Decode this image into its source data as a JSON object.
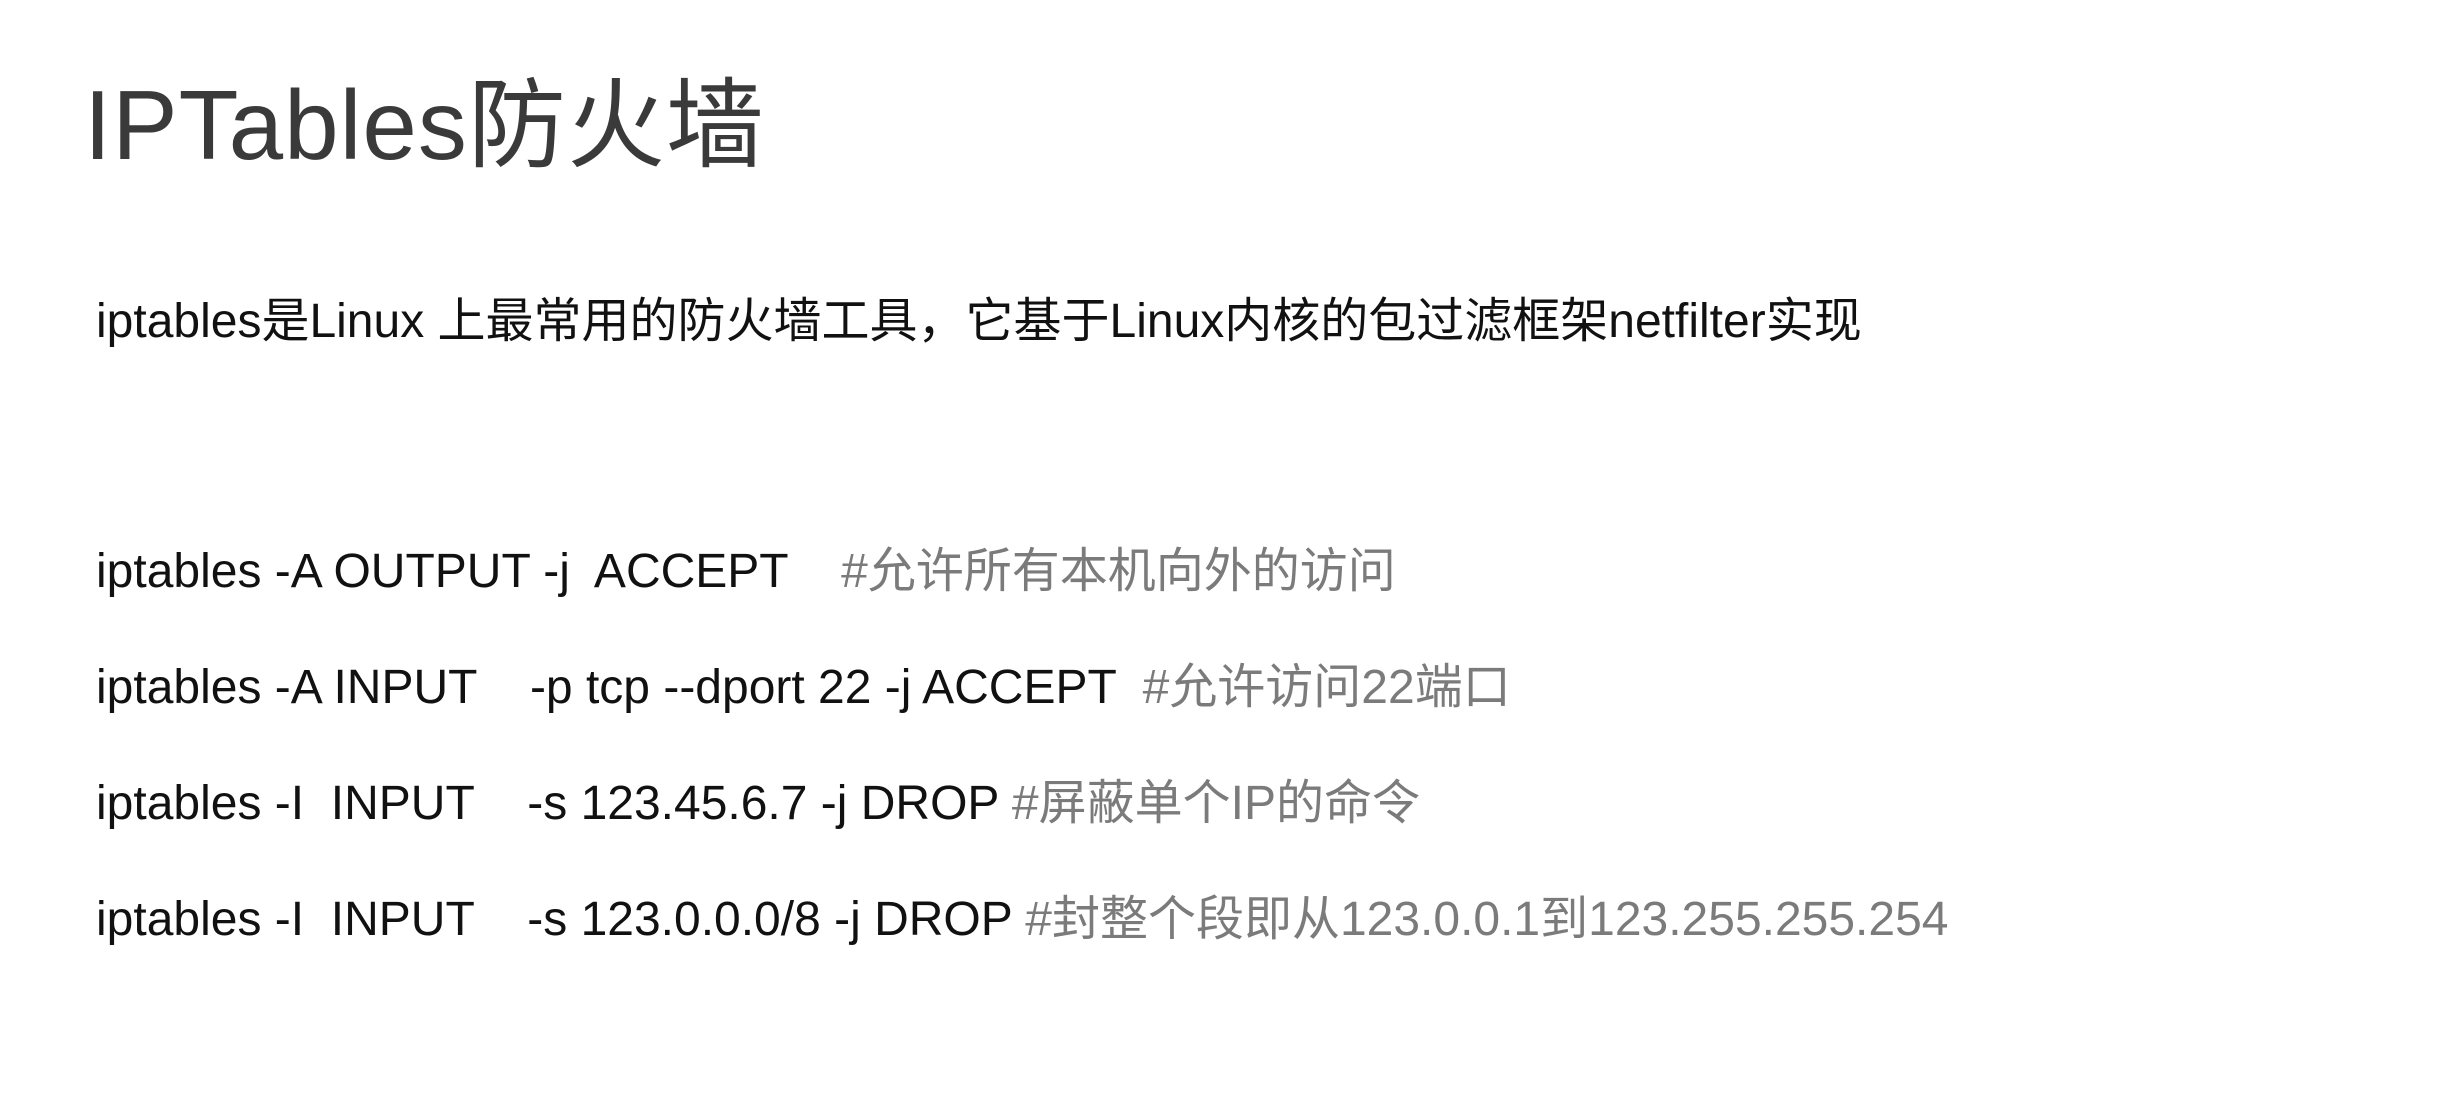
{
  "slide": {
    "title": "IPTables防火墙",
    "intro": "iptables是Linux 上最常用的防火墙工具，它基于Linux内核的包过滤框架netfilter实现",
    "commands": [
      {
        "code": "iptables -A OUTPUT -j  ACCEPT    ",
        "comment": "#允许所有本机向外的访问"
      },
      {
        "code": "iptables -A INPUT    -p tcp --dport 22 -j ACCEPT  ",
        "comment": "#允许访问22端口"
      },
      {
        "code": "iptables -I  INPUT    -s 123.45.6.7 -j DROP ",
        "comment": "#屏蔽单个IP的命令"
      },
      {
        "code": "iptables -I  INPUT    -s 123.0.0.0/8 -j DROP ",
        "comment": "#封整个段即从123.0.0.1到123.255.255.254"
      }
    ]
  },
  "colors": {
    "title": "#3a3a3a",
    "text": "#111111",
    "comment": "#7b7b7b",
    "background": "#ffffff"
  }
}
